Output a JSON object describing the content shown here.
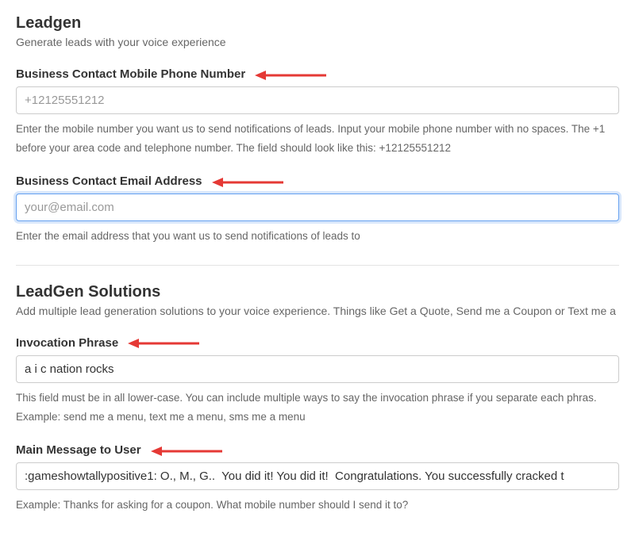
{
  "leadgen": {
    "title": "Leadgen",
    "subtitle": "Generate leads with your voice experience",
    "phone": {
      "label": "Business Contact Mobile Phone Number",
      "placeholder": "+12125551212",
      "value": "",
      "help": "Enter the mobile number you want us to send notifications of leads. Input your mobile phone number with no spaces. The +1 before your area code and telephone number. The field should look like this: +12125551212"
    },
    "email": {
      "label": "Business Contact Email Address",
      "placeholder": "your@email.com",
      "value": "",
      "help": "Enter the email address that you want us to send notifications of leads to"
    }
  },
  "solutions": {
    "title": "LeadGen Solutions",
    "subtitle": "Add multiple lead generation solutions to your voice experience. Things like Get a Quote, Send me a Coupon or Text me a",
    "invocation": {
      "label": "Invocation Phrase",
      "value": "a i c nation rocks",
      "help": "This field must be in all lower-case. You can include multiple ways to say the invocation phrase if you separate each phras. Example: send me a menu, text me a menu, sms me a menu"
    },
    "main_message": {
      "label": "Main Message to User",
      "value": ":gameshowtallypositive1: O., M., G..  You did it! You did it!  Congratulations. You successfully cracked t",
      "help": "Example: Thanks for asking for a coupon. What mobile number should I send it to?"
    }
  }
}
